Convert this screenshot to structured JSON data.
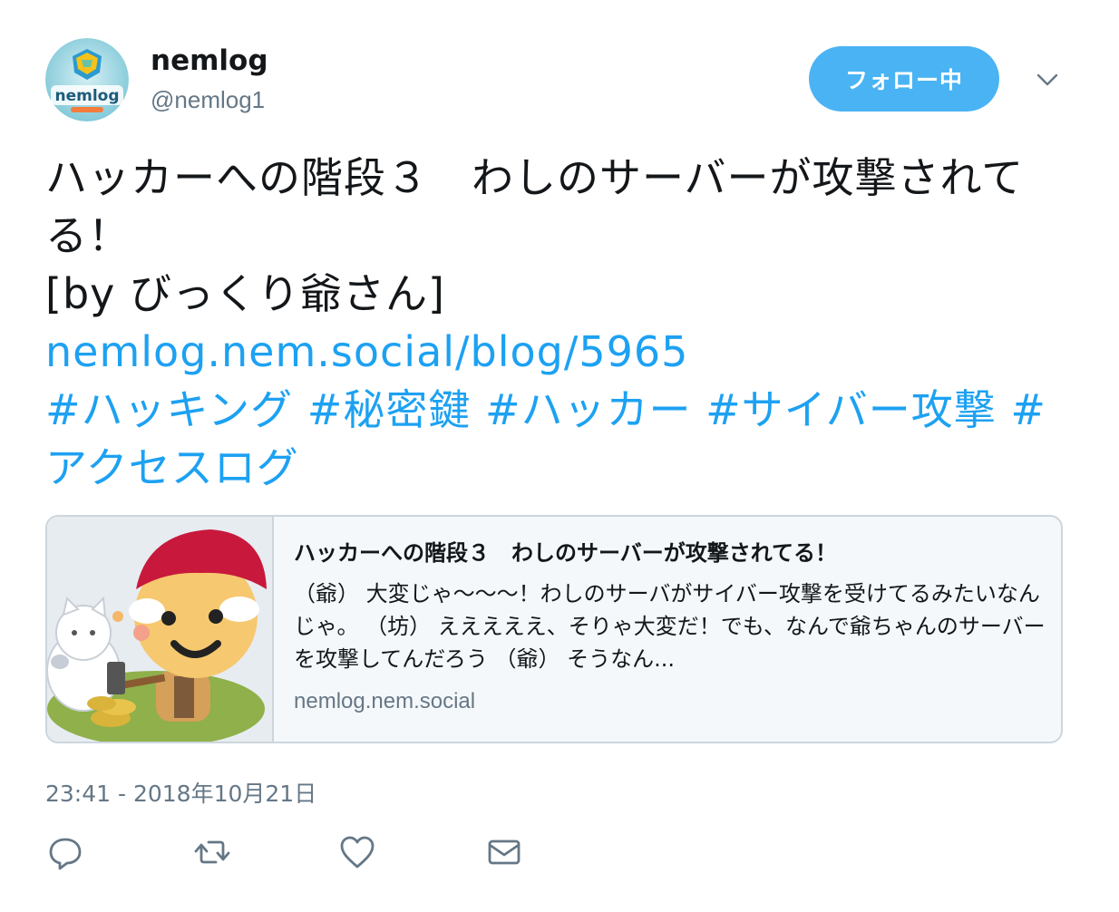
{
  "user": {
    "display_name": "nemlog",
    "handle": "@nemlog1",
    "avatar_text": "nemlog"
  },
  "follow_button": {
    "label": "フォロー中"
  },
  "tweet": {
    "text_line1": "ハッカーへの階段３　わしのサーバーが攻撃されてる！",
    "text_line2": "[by びっくり爺さん]",
    "link": "nemlog.nem.social/blog/5965",
    "hashtags": "#ハッキング #秘密鍵 #ハッカー #サイバー攻撃 #アクセスログ"
  },
  "card": {
    "title": "ハッカーへの階段３　わしのサーバーが攻撃されてる！",
    "description": "（爺） 大変じゃ〜〜〜！わしのサーバがサイバー攻撃を受けてるみたいなんじゃ。 （坊） えええええ、そりゃ大変だ！でも、なんで爺ちゃんのサーバーを攻撃してんだろう （爺） そうなん...",
    "domain": "nemlog.nem.social"
  },
  "timestamp": "23:41 - 2018年10月21日",
  "icons": {
    "caret": "chevron-down-icon",
    "reply": "reply-icon",
    "retweet": "retweet-icon",
    "like": "heart-icon",
    "dm": "envelope-icon"
  },
  "colors": {
    "accent": "#1da1f2",
    "follow_bg": "#4ab3f4",
    "muted": "#657786",
    "border": "#ccd6dd"
  }
}
